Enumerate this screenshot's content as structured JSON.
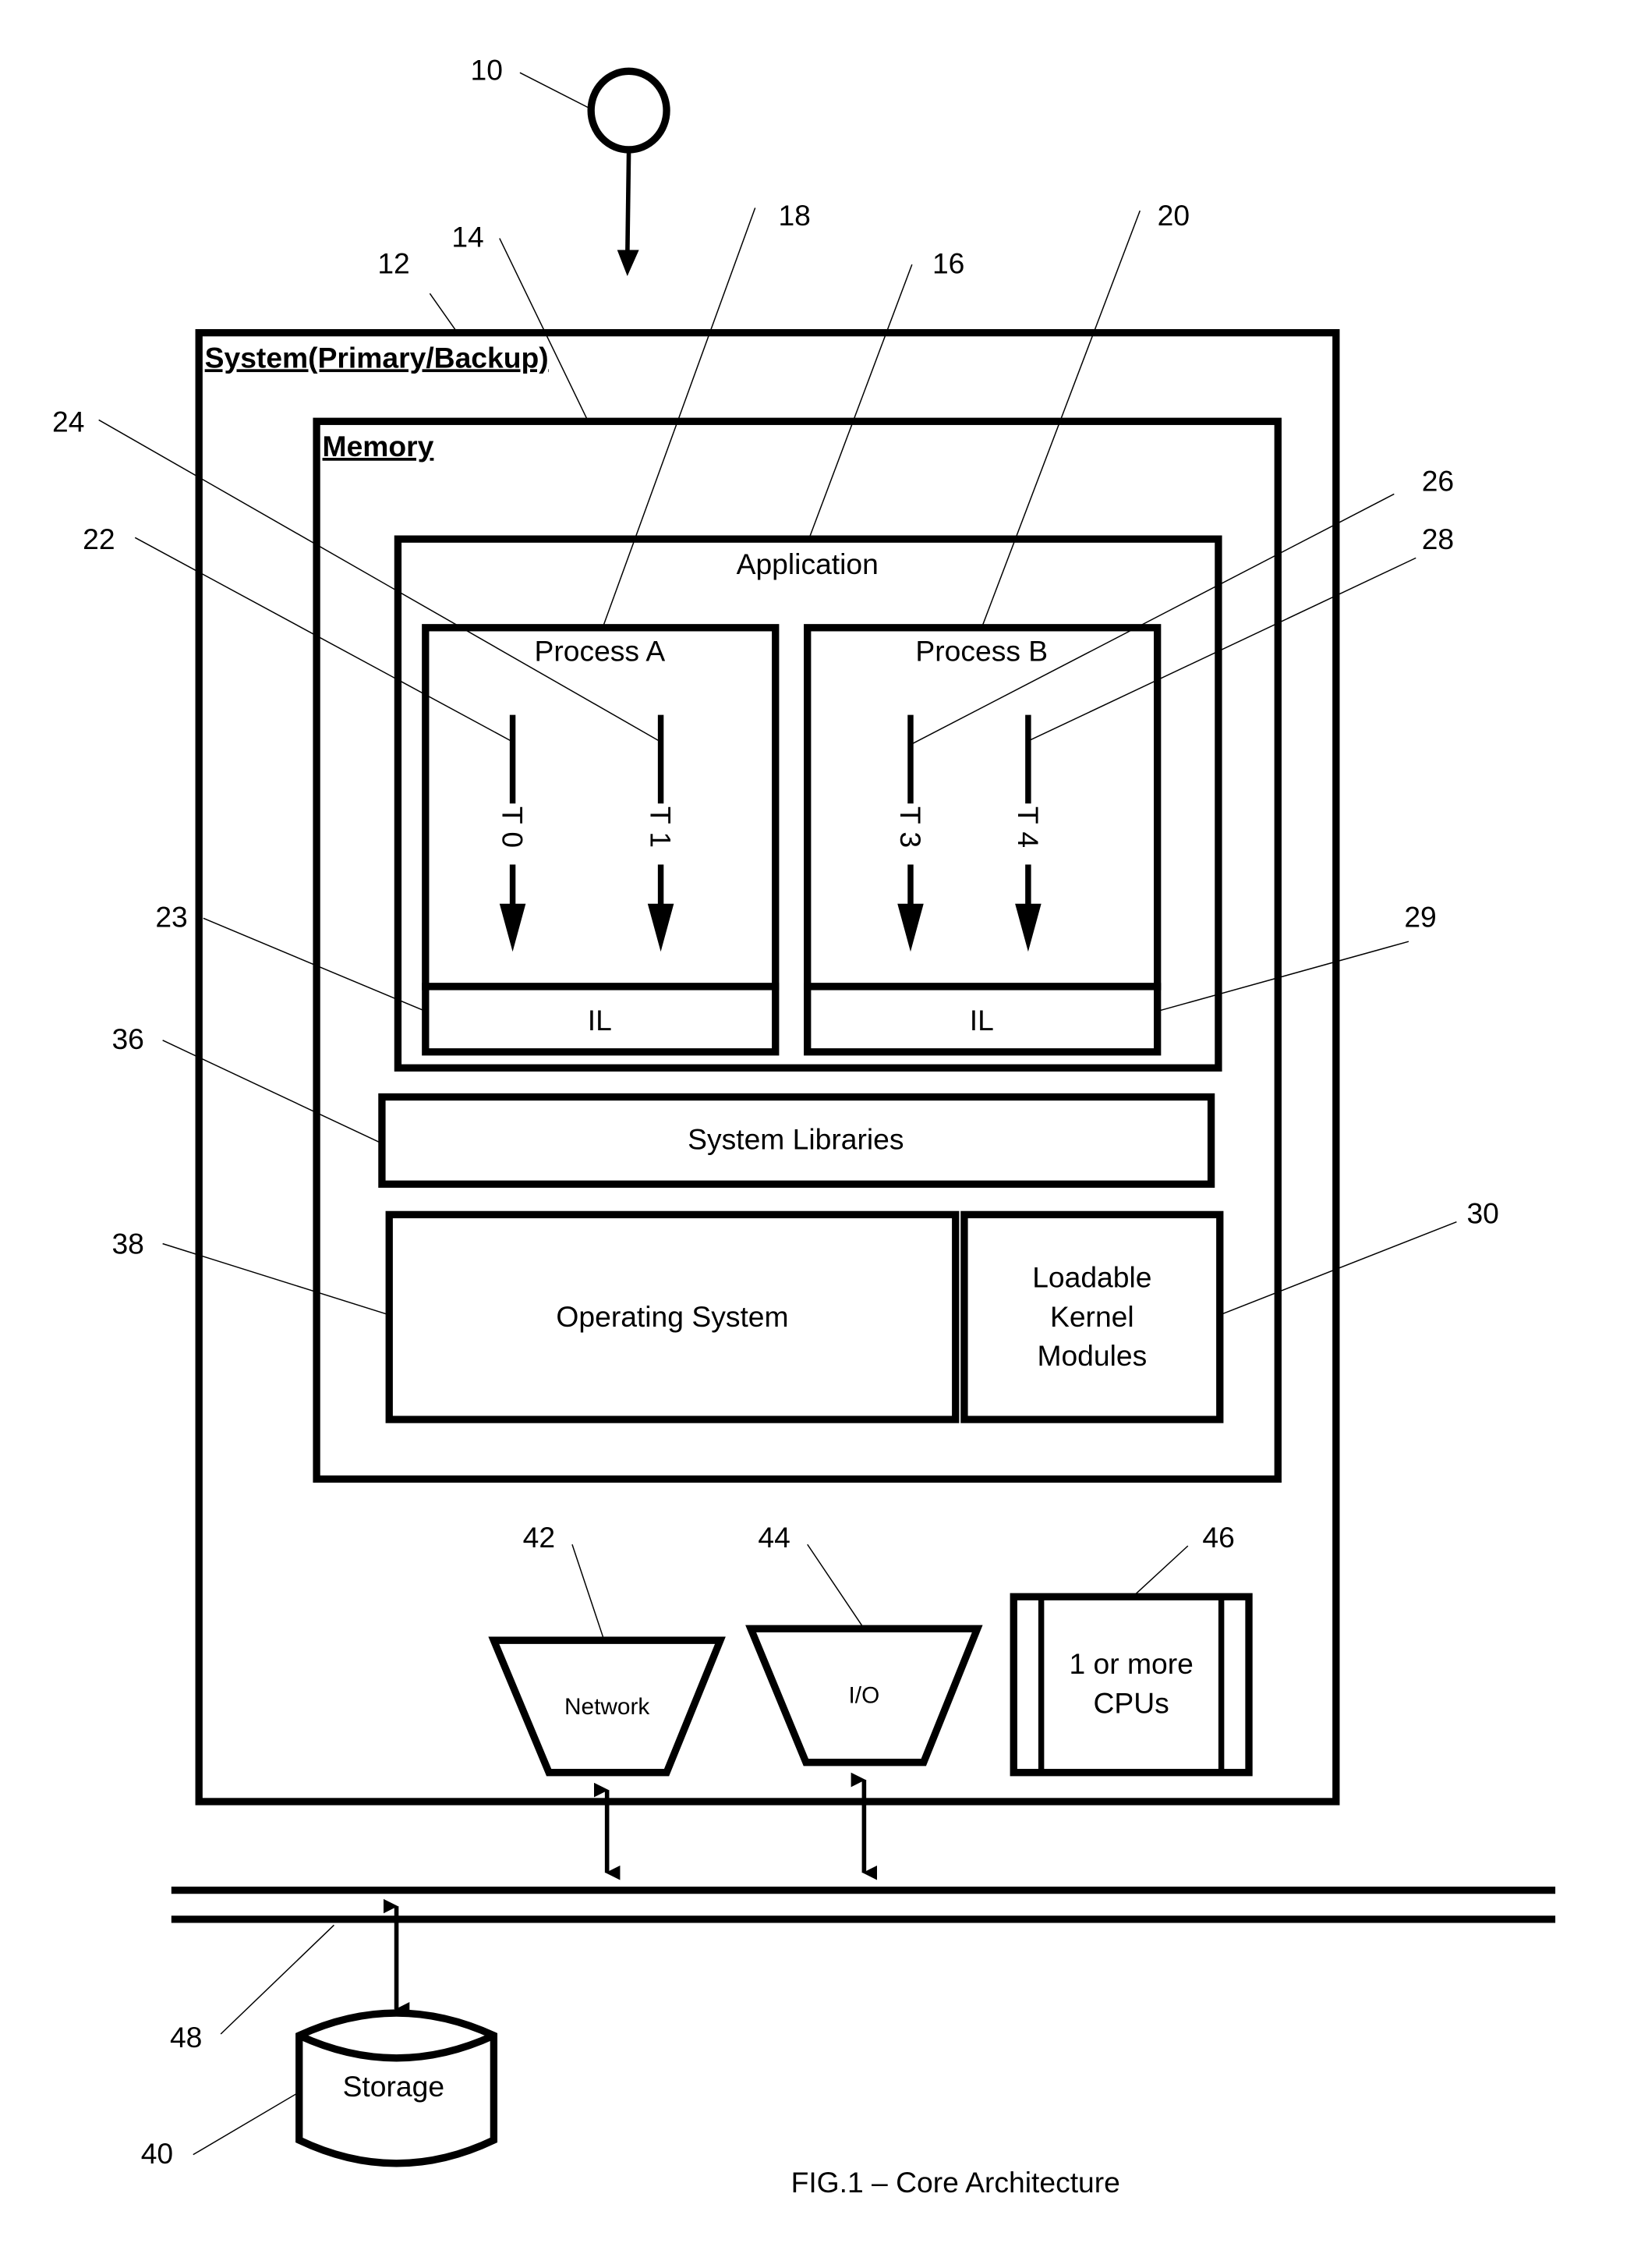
{
  "figure": {
    "caption": "FIG.1  – Core Architecture",
    "system_title": "System(Primary/Backup)",
    "memory_title": "Memory",
    "application": "Application",
    "process_a": "Process A",
    "process_b": "Process B",
    "threads": [
      "T 0",
      "T 1",
      "T 3",
      "T 4"
    ],
    "il": "IL",
    "system_libraries": "System Libraries",
    "operating_system": "Operating System",
    "lkm": [
      "Loadable",
      "Kernel",
      "Modules"
    ],
    "network": "Network",
    "io": "I/O",
    "cpus": [
      "1 or more",
      "CPUs"
    ],
    "storage": "Storage"
  },
  "refs": {
    "r10": "10",
    "r12": "12",
    "r14": "14",
    "r16": "16",
    "r18": "18",
    "r20": "20",
    "r22": "22",
    "r23": "23",
    "r24": "24",
    "r26": "26",
    "r28": "28",
    "r29": "29",
    "r30": "30",
    "r36": "36",
    "r38": "38",
    "r40": "40",
    "r42": "42",
    "r44": "44",
    "r46": "46",
    "r48": "48"
  }
}
